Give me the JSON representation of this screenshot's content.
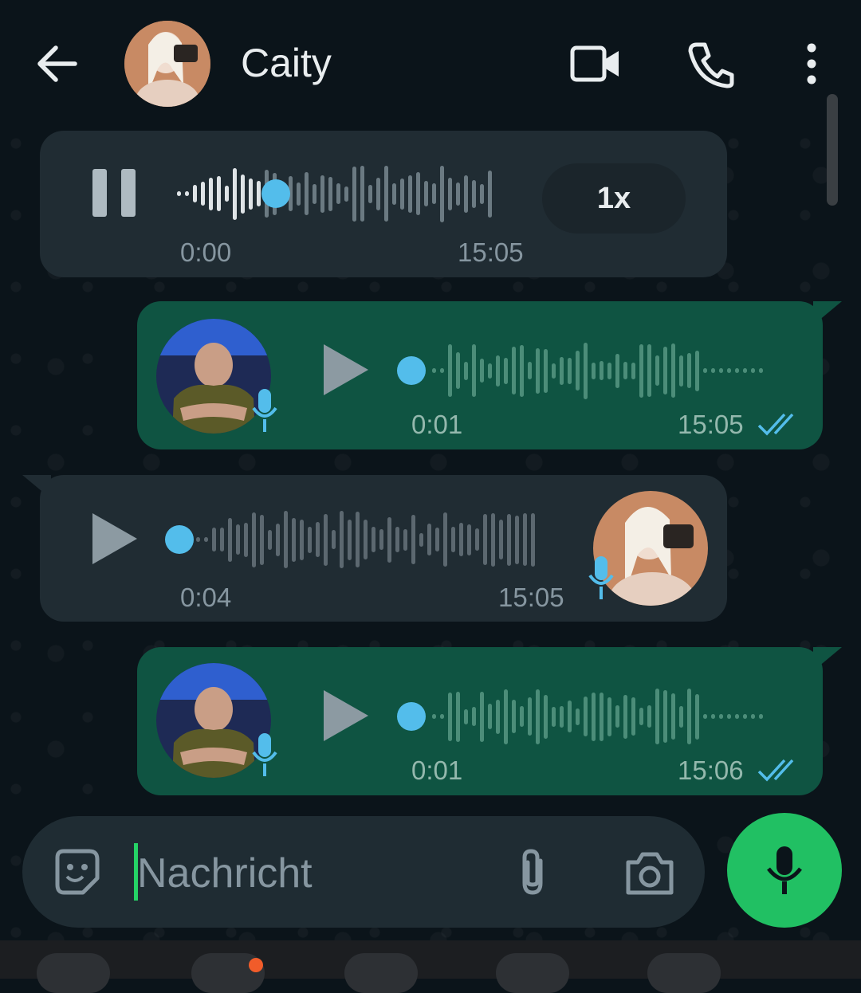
{
  "header": {
    "contact_name": "Caity"
  },
  "messages": [
    {
      "direction": "in",
      "state": "playing",
      "elapsed": "0:00",
      "time": "15:05",
      "speed": "1x"
    },
    {
      "direction": "out",
      "elapsed": "0:01",
      "time": "15:05",
      "read": true
    },
    {
      "direction": "in",
      "elapsed": "0:04",
      "time": "15:05"
    },
    {
      "direction": "out",
      "elapsed": "0:01",
      "time": "15:06",
      "read": true
    }
  ],
  "composer": {
    "placeholder": "Nachricht"
  },
  "colors": {
    "accent": "#53bdeb",
    "outgoing": "#0f5442",
    "incoming": "#202c33",
    "mic": "#21c063"
  }
}
